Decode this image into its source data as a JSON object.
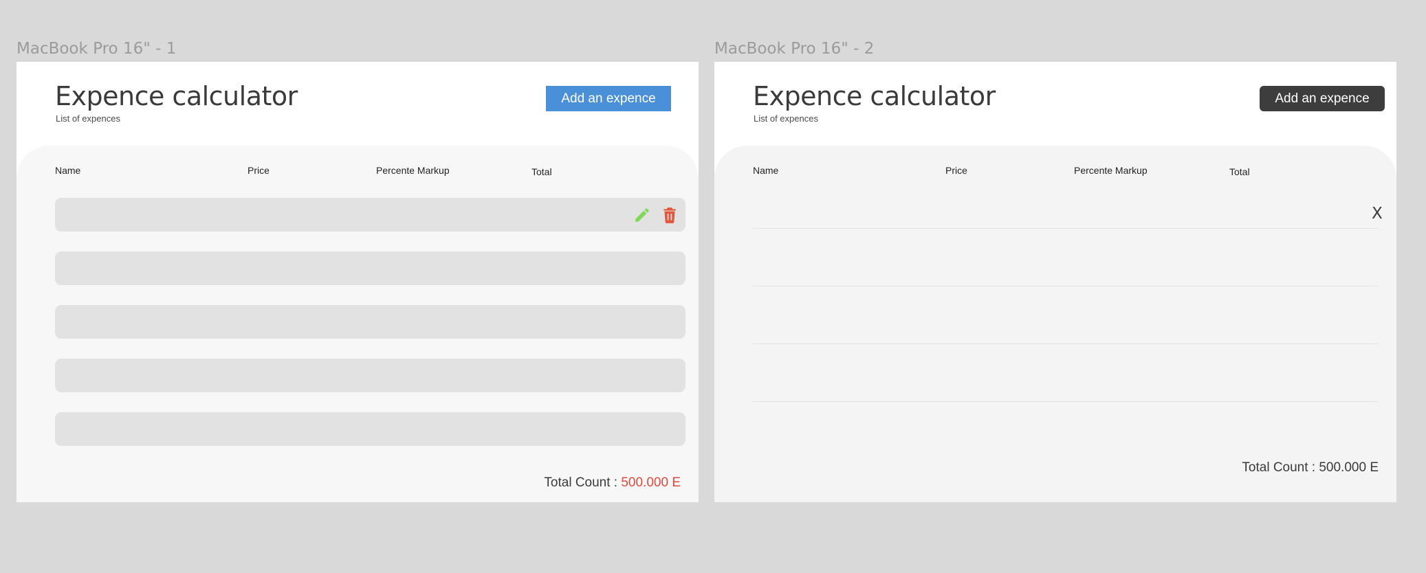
{
  "frames": [
    {
      "label": "MacBook Pro 16\" - 1",
      "title": "Expence calculator",
      "subtitle": "List of expences",
      "add_button": "Add an expence",
      "columns": [
        "Name",
        "Price",
        "Percente Markup",
        "Total"
      ],
      "rows": 5,
      "total_label": "Total Count : ",
      "total_value": "500.000 E",
      "icons": [
        "pencil-icon",
        "trash-icon"
      ],
      "colors": {
        "accent": "#4a90d9",
        "edit": "#7ed957",
        "delete": "#e0573a",
        "total_value": "#e04a3a"
      }
    },
    {
      "label": "MacBook Pro 16\" - 2",
      "title": "Expence calculator",
      "subtitle": "List of expences",
      "add_button": "Add an expence",
      "columns": [
        "Name",
        "Price",
        "Percente Markup",
        "Total"
      ],
      "close_label": "X",
      "total_label": "Total Count : ",
      "total_value": "500.000 E",
      "colors": {
        "accent": "#3d3d3d"
      }
    }
  ]
}
